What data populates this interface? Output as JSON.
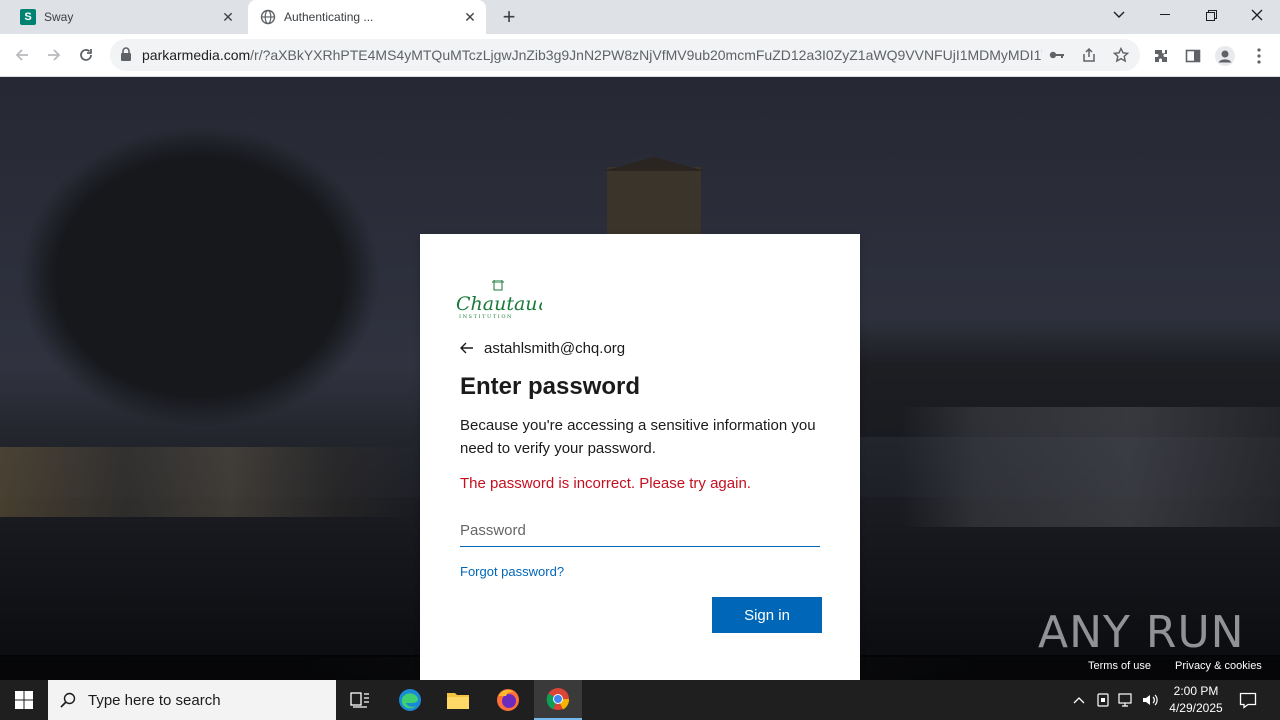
{
  "browser": {
    "tabs": [
      {
        "title": "Sway",
        "icon": "sway-icon"
      },
      {
        "title": "Authenticating ...",
        "icon": "globe-icon"
      }
    ],
    "new_tab_label": "+",
    "url": {
      "host": "parkarmedia.com",
      "path": "/r/?aXBkYXRhPTE4MS4yMTQuMTczLjgwJnZib3g9JnN2PW8zNjVfMV9ub20mcmFuZD12a3I0ZyZ1aWQ9VVNFUjI1MDMyMDI1V..."
    }
  },
  "signin": {
    "org_logo_text": "Chautauqua",
    "org_logo_subtext": "INSTITUTION",
    "identity": "astahlsmith@chq.org",
    "heading": "Enter password",
    "description": "Because you're accessing a sensitive information you need to verify your password.",
    "error": "The password is incorrect. Please try again.",
    "password_placeholder": "Password",
    "forgot_label": "Forgot password?",
    "signin_label": "Sign in"
  },
  "page_footer": {
    "terms": "Terms of use",
    "privacy": "Privacy & cookies"
  },
  "watermark": "ANY RUN",
  "taskbar": {
    "search_placeholder": "Type here to search",
    "time": "2:00 PM",
    "date": "4/29/2025"
  },
  "colors": {
    "accent": "#0067b8",
    "error": "#c50f1f",
    "logo_green": "#1a7a3a"
  }
}
